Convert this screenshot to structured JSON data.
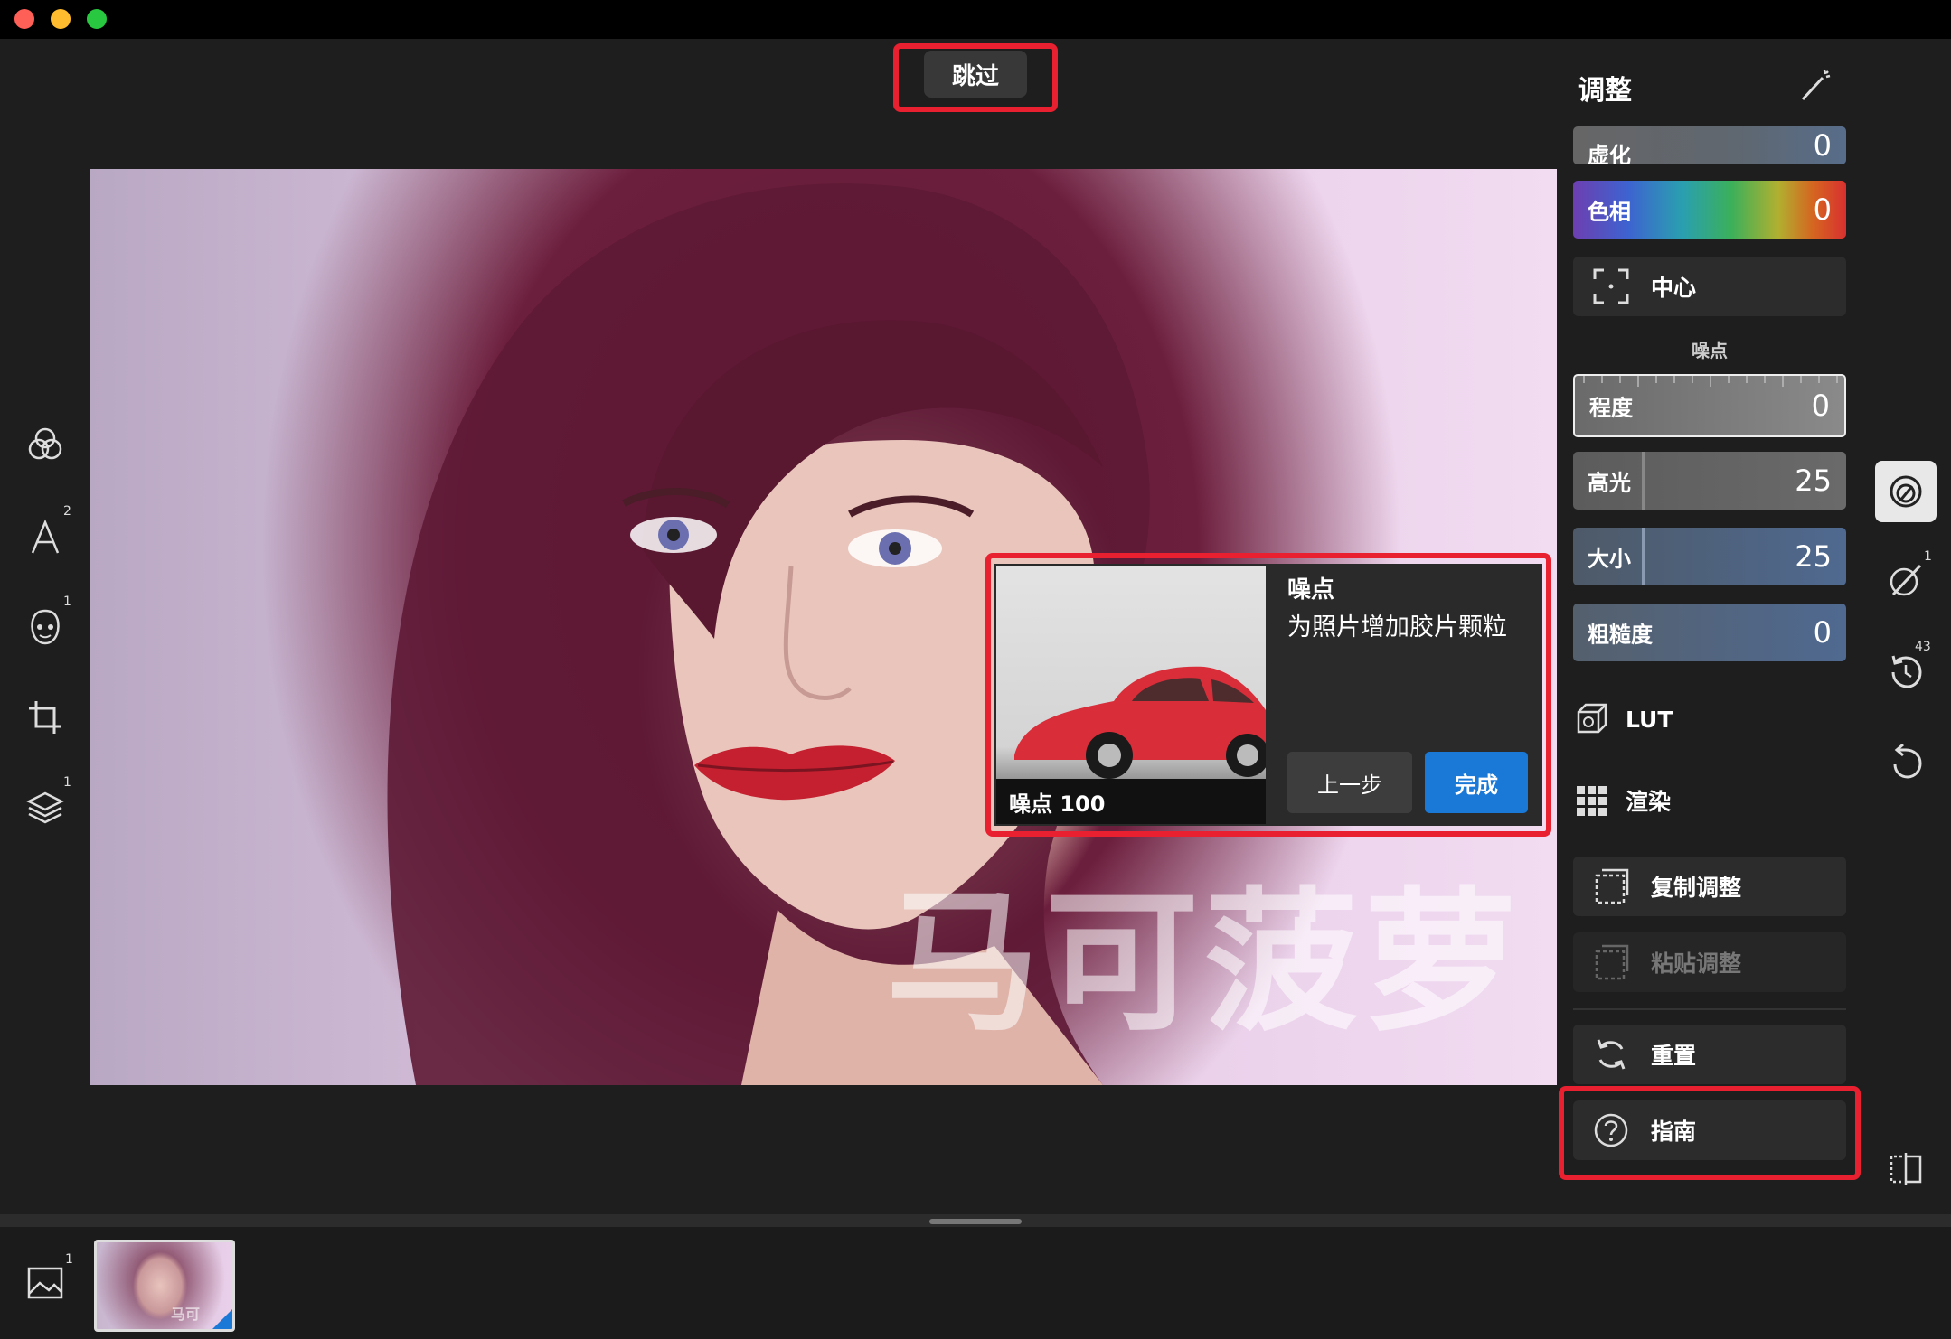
{
  "skip_button": "跳过",
  "panel": {
    "title": "调整",
    "sliders": [
      {
        "label": "虚化",
        "value": "0"
      },
      {
        "label": "色相",
        "value": "0"
      },
      {
        "label": "程度",
        "value": "0"
      },
      {
        "label": "高光",
        "value": "25"
      },
      {
        "label": "大小",
        "value": "25"
      },
      {
        "label": "粗糙度",
        "value": "0"
      }
    ],
    "center_button": "中心",
    "noise_section": "噪点",
    "lut": "LUT",
    "render": "渲染",
    "copy_adjust": "复制调整",
    "paste_adjust": "粘贴调整",
    "reset": "重置",
    "guide": "指南"
  },
  "tooltip": {
    "title": "噪点",
    "description": "为照片增加胶片颗粒",
    "image_caption": "噪点 100",
    "prev_button": "上一步",
    "done_button": "完成"
  },
  "watermark": "马可菠萝",
  "thumb_watermark": "马可",
  "left_toolbar_badges": {
    "text": "2",
    "face": "1",
    "layers": "1"
  },
  "right_toolbar_badges": {
    "retouch": "1",
    "history": "43"
  },
  "filmstrip_badge": "1",
  "colors": {
    "accent_blue": "#1a78d6",
    "highlight_red": "#e8202f"
  }
}
